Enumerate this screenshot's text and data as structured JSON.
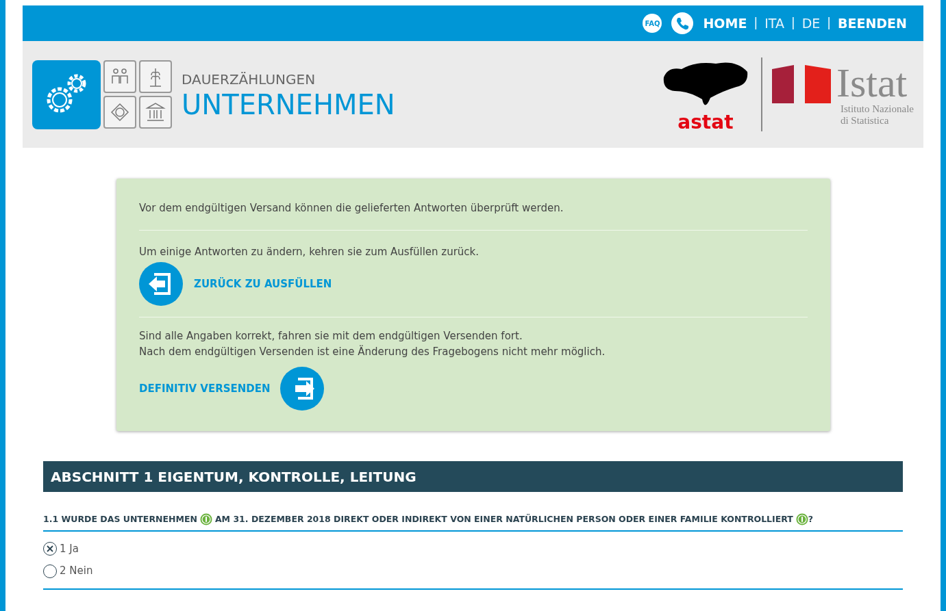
{
  "topbar": {
    "faq": "FAQ",
    "links": [
      {
        "kind": "link",
        "label": "HOME",
        "bold": true
      },
      {
        "kind": "separator",
        "label": "|"
      },
      {
        "kind": "link",
        "label": "ITA",
        "bold": false
      },
      {
        "kind": "separator",
        "label": "|"
      },
      {
        "kind": "link",
        "label": "DE",
        "bold": false
      },
      {
        "kind": "separator",
        "label": "|"
      },
      {
        "kind": "link",
        "label": "BEENDEN",
        "bold": true
      }
    ]
  },
  "header": {
    "subtitle": "DAUERZÄHLUNGEN",
    "title": "UNTERNEHMEN",
    "astat": "astat",
    "istat": "Istat",
    "istat_sub": [
      "Istituto Nazionale",
      "di Statistica"
    ]
  },
  "notice": {
    "intro": "Vor dem endgültigen Versand können die gelieferten Antworten überprüft werden.",
    "back_text": "Um einige Antworten zu ändern, kehren sie zum Ausfüllen zurück.",
    "back_button": "ZURÜCK ZU AUSFÜLLEN",
    "send_text": [
      "Sind alle Angaben korrekt, fahren sie mit dem endgültigen Versenden fort.",
      "Nach dem endgültigen Versenden ist eine Änderung des Fragebogens nicht mehr möglich."
    ],
    "send_button": "DEFINITIV VERSENDEN"
  },
  "section": {
    "title": "ABSCHNITT 1 EIGENTUM, KONTROLLE, LEITUNG",
    "question": [
      "1.1 WURDE DAS UNTERNEHMEN",
      "AM 31. DEZEMBER 2018 DIREKT ODER INDIREKT VON EINER NATÜRLICHEN PERSON ODER EINER FAMILIE KONTROLLIERT",
      "?"
    ],
    "options": [
      {
        "label": "1 Ja",
        "selected": true
      },
      {
        "label": "2 Nein",
        "selected": false
      }
    ]
  }
}
